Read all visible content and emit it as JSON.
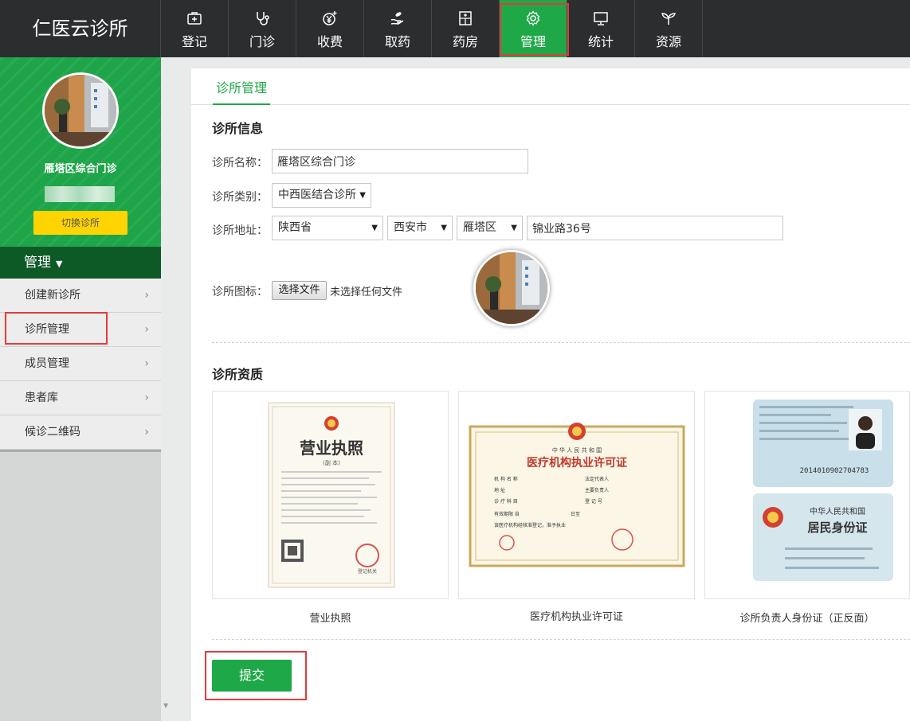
{
  "app": {
    "brand": "仁医云诊所"
  },
  "nav": [
    {
      "label": "登记",
      "icon": "plus-box-icon"
    },
    {
      "label": "门诊",
      "icon": "stethoscope-icon"
    },
    {
      "label": "收费",
      "icon": "yen-coin-icon"
    },
    {
      "label": "取药",
      "icon": "hand-pill-icon"
    },
    {
      "label": "药房",
      "icon": "pharmacy-cabinet-icon"
    },
    {
      "label": "管理",
      "icon": "gear-icon",
      "active": true
    },
    {
      "label": "统计",
      "icon": "monitor-icon"
    },
    {
      "label": "资源",
      "icon": "sprout-icon"
    }
  ],
  "sidebar": {
    "clinic_name": "雁塔区综合门诊",
    "switch_label": "切换诊所",
    "menu_title": "管理",
    "items": [
      {
        "label": "创建新诊所"
      },
      {
        "label": "诊所管理",
        "selected": true
      },
      {
        "label": "成员管理"
      },
      {
        "label": "患者库"
      },
      {
        "label": "候诊二维码"
      }
    ]
  },
  "main": {
    "tab": "诊所管理",
    "info_title": "诊所信息",
    "fields": {
      "name_label": "诊所名称：",
      "name_value": "雁塔区综合门诊",
      "type_label": "诊所类别：",
      "type_value": "中西医结合诊所",
      "address_label": "诊所地址：",
      "province": "陕西省",
      "city": "西安市",
      "district": "雁塔区",
      "street": "锦业路36号",
      "icon_label": "诊所图标：",
      "file_button": "选择文件",
      "file_status": "未选择任何文件"
    },
    "qualification_title": "诊所资质",
    "documents": [
      {
        "caption": "营业执照",
        "title": "营业执照",
        "subtitle": "(副  本)",
        "seal_text": "登记机关"
      },
      {
        "caption": "医疗机构执业许可证",
        "country": "中 华 人 民 共 和 国",
        "title": "医疗机构执业许可证",
        "rows": [
          [
            "机 构 名 称",
            "法定代表人"
          ],
          [
            "地      址",
            "主要负责人"
          ],
          [
            "诊 疗 科 目",
            "登 记 号"
          ],
          [
            "有效期限 自",
            "日至"
          ]
        ],
        "statement": "该医疗机构经核准登记，准予执业"
      },
      {
        "caption": "诊所负责人身份证（正反面）",
        "id_number": "2014010902704783",
        "country": "中华人民共和国",
        "card_title": "居民身份证"
      }
    ],
    "submit_label": "提交"
  }
}
